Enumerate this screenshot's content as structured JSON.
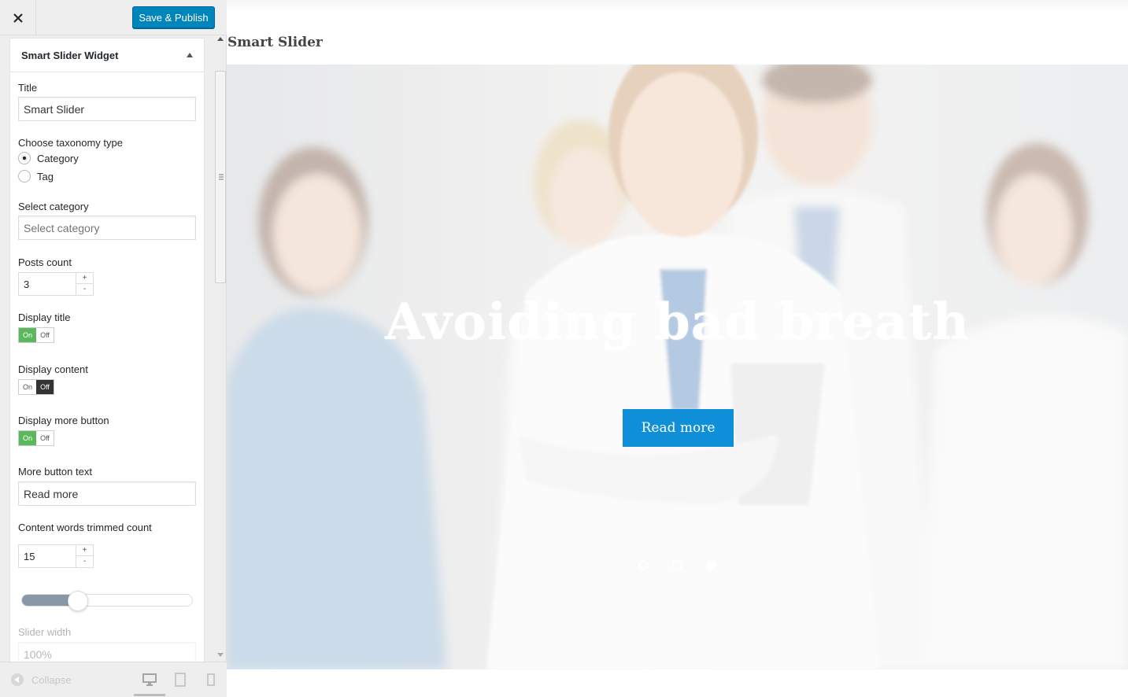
{
  "topbar": {
    "close_label": "×",
    "publish_label": "Save & Publish"
  },
  "widget": {
    "header_title": "Smart Slider Widget",
    "title_label": "Title",
    "title_value": "Smart Slider",
    "taxonomy_label": "Choose taxonomy type",
    "taxonomy_options": [
      "Category",
      "Tag"
    ],
    "taxonomy_selected": "Category",
    "category_label": "Select category",
    "category_placeholder": "Select category",
    "posts_count_label": "Posts count",
    "posts_count_value": "3",
    "display_title_label": "Display title",
    "display_title_state": "On",
    "display_content_label": "Display content",
    "display_content_state": "Off",
    "display_more_label": "Display more button",
    "display_more_state": "On",
    "toggle_on_text": "On",
    "toggle_off_text": "Off",
    "stepper_plus": "+",
    "stepper_minus": "-",
    "more_text_label": "More button text",
    "more_text_value": "Read more",
    "trim_label": "Content words trimmed count",
    "trim_value": "15",
    "trim_slider_level": 0.26,
    "slider_width_label": "Slider width",
    "slider_width_value": "100%"
  },
  "footer": {
    "collapse_label": "Collapse",
    "devices": [
      "desktop-icon",
      "tablet-icon",
      "mobile-icon"
    ],
    "active_device": "desktop"
  },
  "preview": {
    "widget_title": "Smart Slider",
    "slide_title": "Avoiding bad breath",
    "slide_button": "Read more",
    "slide_count": 3,
    "active_slide": 3
  },
  "colors": {
    "publish": "#0085ba",
    "toggle_on": "#5cb85c",
    "toggle_off": "#333333",
    "read_more": "#0f8fd8"
  }
}
